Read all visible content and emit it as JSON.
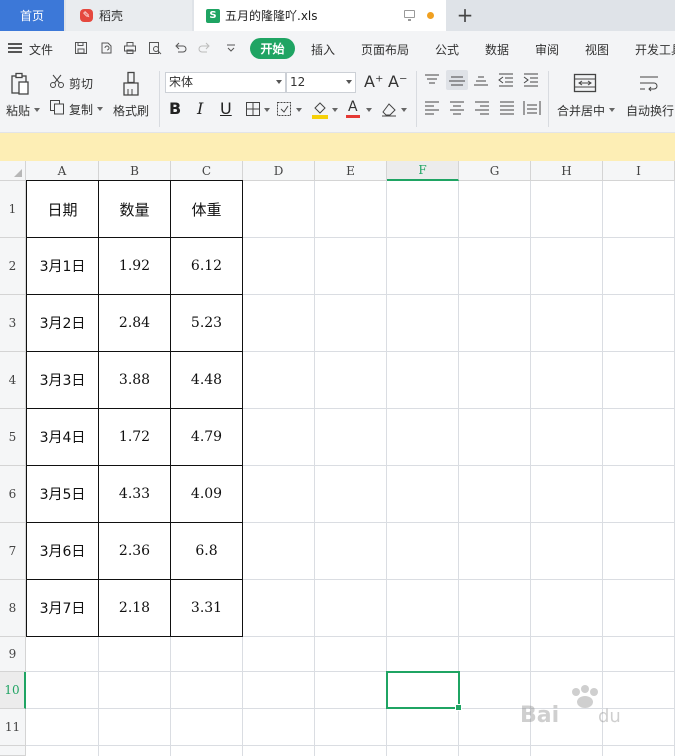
{
  "tabs": {
    "home": "首页",
    "daoke": "稻壳",
    "file": "五月的隆隆吖.xls",
    "new_tab": "+"
  },
  "menu": {
    "file": "文件",
    "start": "开始",
    "items": [
      "插入",
      "页面布局",
      "公式",
      "数据",
      "审阅",
      "视图",
      "开发工具"
    ]
  },
  "toolbar": {
    "paste": "粘贴",
    "cut": "剪切",
    "copy": "复制",
    "format_painter": "格式刷",
    "font_name": "宋体",
    "font_size": "12",
    "increase_font": "A⁺",
    "decrease_font": "A⁻",
    "bold": "B",
    "italic": "I",
    "underline": "U",
    "merge_center": "合并居中",
    "wrap_text": "自动换行"
  },
  "sheet": {
    "columns": [
      "A",
      "B",
      "C",
      "D",
      "E",
      "F",
      "G",
      "H",
      "I"
    ],
    "active_column": "F",
    "rows": [
      "1",
      "2",
      "3",
      "4",
      "5",
      "6",
      "7",
      "8",
      "9",
      "10",
      "11"
    ],
    "active_row": "10",
    "header": [
      "日期",
      "数量",
      "体重"
    ],
    "data": [
      [
        "3月1日",
        "1.92",
        "6.12"
      ],
      [
        "3月2日",
        "2.84",
        "5.23"
      ],
      [
        "3月3日",
        "3.88",
        "4.48"
      ],
      [
        "3月4日",
        "1.72",
        "4.79"
      ],
      [
        "3月5日",
        "4.33",
        "4.09"
      ],
      [
        "3月6日",
        "2.36",
        "6.8"
      ],
      [
        "3月7日",
        "2.18",
        "3.31"
      ]
    ]
  },
  "colors": {
    "accent": "#1fa463",
    "home_tab": "#3c78d8",
    "banner": "#fdeeb5"
  }
}
